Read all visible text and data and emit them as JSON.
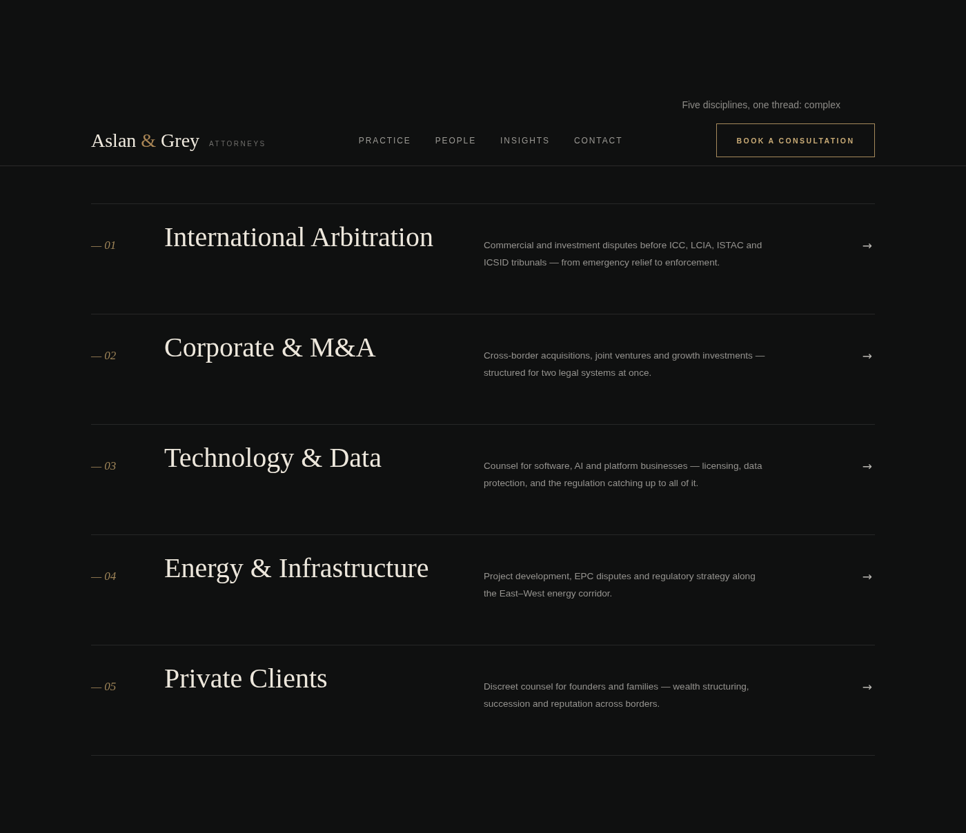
{
  "tagline": "Five disciplines, one thread: complex",
  "header": {
    "logo": {
      "first": "Aslan",
      "ampersand": "&",
      "last": "Grey",
      "suffix": "ATTORNEYS"
    },
    "nav": [
      {
        "label": "PRACTICE"
      },
      {
        "label": "PEOPLE"
      },
      {
        "label": "INSIGHTS"
      },
      {
        "label": "CONTACT"
      }
    ],
    "cta": "BOOK A CONSULTATION"
  },
  "practices": [
    {
      "number": "— 01",
      "title": "International Arbitration",
      "description": "Commercial and investment disputes before ICC, LCIA, ISTAC and ICSID tribunals — from emergency relief to enforcement.",
      "arrow": "→"
    },
    {
      "number": "— 02",
      "title": "Corporate & M&A",
      "description": "Cross-border acquisitions, joint ventures and growth investments — structured for two legal systems at once.",
      "arrow": "→"
    },
    {
      "number": "— 03",
      "title": "Technology & Data",
      "description": "Counsel for software, AI and platform businesses — licensing, data protection, and the regulation catching up to all of it.",
      "arrow": "→"
    },
    {
      "number": "— 04",
      "title": "Energy & Infrastructure",
      "description": "Project development, EPC disputes and regulatory strategy along the East–West energy corridor.",
      "arrow": "→"
    },
    {
      "number": "— 05",
      "title": "Private Clients",
      "description": "Discreet counsel for founders and families — wealth structuring, succession and reputation across borders.",
      "arrow": "→"
    }
  ]
}
